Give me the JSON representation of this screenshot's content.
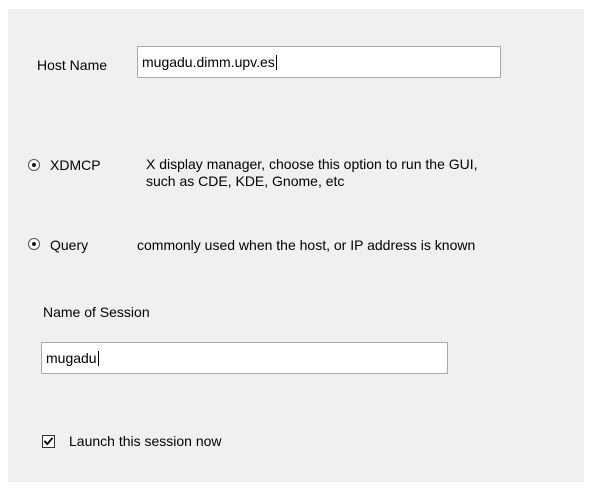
{
  "host": {
    "label": "Host Name",
    "value": "mugadu.dimm.upv.es"
  },
  "options": {
    "xdmcp": {
      "label": "XDMCP",
      "description_line1": "X display manager, choose this option to run the GUI,",
      "description_line2": "such as CDE, KDE, Gnome, etc",
      "selected": true
    },
    "query": {
      "label": "Query",
      "description": "commonly used when the host, or IP address is known",
      "selected": true
    }
  },
  "session": {
    "label": "Name of Session",
    "value": "mugadu"
  },
  "launch": {
    "label": "Launch this session now",
    "checked": true
  },
  "colors": {
    "panel_background": "#f0f0f0",
    "page_background": "#ffffff",
    "field_border": "#a9a9a9"
  }
}
